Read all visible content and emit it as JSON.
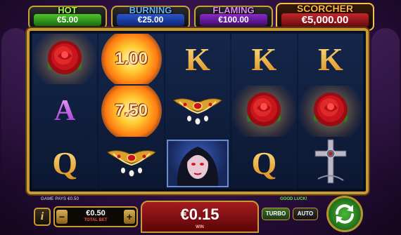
{
  "jackpots": {
    "hot": {
      "name": "HOT",
      "value": "€5.00"
    },
    "burning": {
      "name": "BURNING",
      "value": "€25.00"
    },
    "flaming": {
      "name": "FLAMING",
      "value": "€100.00"
    },
    "scorcher": {
      "name": "SCORCHER",
      "value": "€5,000.00"
    }
  },
  "reels": [
    [
      {
        "symbol": "rose",
        "glow": true
      },
      {
        "symbol": "letter",
        "text": "A"
      },
      {
        "symbol": "letter",
        "text": "Q"
      }
    ],
    [
      {
        "symbol": "fireball",
        "text": "1.00"
      },
      {
        "symbol": "fireball",
        "text": "7.50"
      },
      {
        "symbol": "jewel"
      }
    ],
    [
      {
        "symbol": "letter",
        "text": "K"
      },
      {
        "symbol": "jewel"
      },
      {
        "symbol": "vampire"
      }
    ],
    [
      {
        "symbol": "letter",
        "text": "K"
      },
      {
        "symbol": "rose",
        "glow": true
      },
      {
        "symbol": "letter",
        "text": "Q"
      }
    ],
    [
      {
        "symbol": "letter",
        "text": "K"
      },
      {
        "symbol": "rose",
        "glow": true
      },
      {
        "symbol": "cross"
      }
    ]
  ],
  "status": {
    "game_pays": "GAME PAYS €0.50",
    "message": "GOOD LUCK!"
  },
  "controls": {
    "info_label": "i",
    "bet_minus": "−",
    "bet_plus": "+",
    "bet_value": "€0.50",
    "bet_label": "TOTAL BET",
    "win_value": "€0.15",
    "win_label": "WIN",
    "turbo_label": "TURBO",
    "auto_label": "AUTO"
  },
  "colors": {
    "gold": "#c99a34",
    "rose_red": "#c8141c",
    "win_red": "#a61b1f",
    "spin_green": "#2e8f24"
  }
}
